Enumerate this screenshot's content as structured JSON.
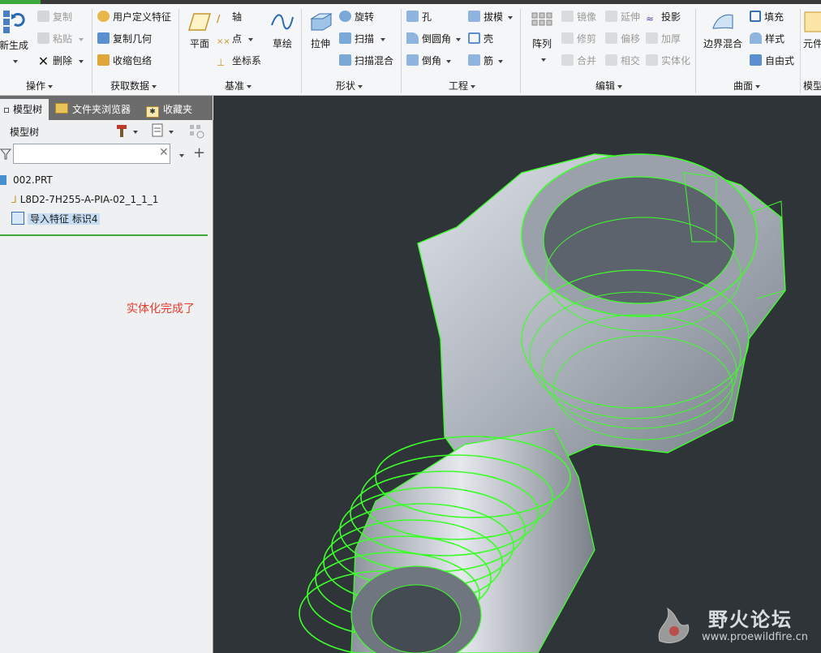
{
  "ribbon": {
    "ops": {
      "regenerate": "新生成",
      "copy": "复制",
      "paste": "粘贴",
      "delete": "删除",
      "label": "操作"
    },
    "getdata": {
      "udf": "用户定义特征",
      "copy_geom": "复制几何",
      "shrinkwrap": "收缩包络",
      "label": "获取数据"
    },
    "datum": {
      "plane": "平面",
      "axis": "轴",
      "point": "点",
      "csys": "坐标系",
      "sketch": "草绘",
      "label": "基准"
    },
    "shapes": {
      "extrude": "拉伸",
      "revolve": "旋转",
      "sweep": "扫描",
      "swept_blend": "扫描混合",
      "label": "形状"
    },
    "engineering": {
      "hole": "孔",
      "round": "倒圆角",
      "chamfer": "倒角",
      "draft": "拔模",
      "shell": "壳",
      "rib": "筋",
      "label": "工程"
    },
    "editing": {
      "pattern": "阵列",
      "mirror": "镜像",
      "extend": "延伸",
      "project": "投影",
      "trim": "修剪",
      "offset": "偏移",
      "thicken": "加厚",
      "merge": "合并",
      "intersect": "相交",
      "solidify": "实体化",
      "label": "编辑"
    },
    "surfaces": {
      "boundary_blend": "边界混合",
      "fill": "填充",
      "style": "样式",
      "freestyle": "自由式",
      "label": "曲面"
    },
    "model_intent": {
      "elem": "元件",
      "label": "模型"
    }
  },
  "tabs": {
    "model_tree": "模型树",
    "folder_browser": "文件夹浏览器",
    "favorites": "收藏夹"
  },
  "tree": {
    "header": "模型树",
    "search_value": "",
    "items": [
      {
        "label": "002.PRT"
      },
      {
        "label": "L8D2-7H255-A-PIA-02_1_1_1"
      },
      {
        "label": "导入特征 标识4"
      }
    ],
    "note": "实体化完成了"
  },
  "watermark": {
    "title": "野火论坛",
    "url": "www.proewildfire.cn"
  },
  "colors": {
    "wire": "#3cff2a",
    "viewport_bg": "#2f3439",
    "note_red": "#e83a2a"
  }
}
